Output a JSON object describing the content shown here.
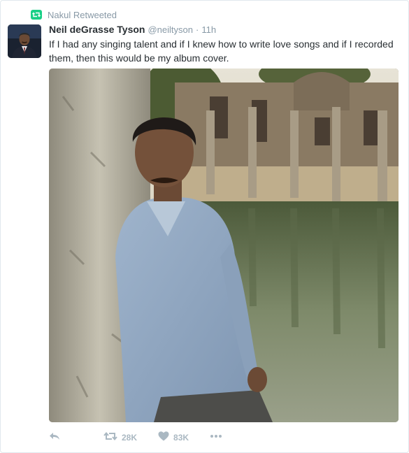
{
  "retweet_context": {
    "label": "Nakul Retweeted",
    "icon": "retweet-icon",
    "color": "#19cf86"
  },
  "tweet": {
    "display_name": "Neil deGrasse Tyson",
    "screen_name": "@neiltyson",
    "separator": "·",
    "timestamp": "11h",
    "text": "If I had any singing talent and if I knew how to write love songs and if I recorded them, then this would be my album cover.",
    "avatar": "user-avatar",
    "media": "photo"
  },
  "actions": {
    "reply": {
      "icon": "reply-icon"
    },
    "retweet": {
      "icon": "retweet-icon",
      "count": "28K"
    },
    "like": {
      "icon": "heart-icon",
      "count": "83K"
    },
    "more": {
      "icon": "more-icon"
    }
  },
  "colors": {
    "text": "#292f33",
    "muted": "#8899a6",
    "action": "#aab8c2",
    "retweet_green": "#19cf86",
    "border": "#e1e8ed"
  }
}
